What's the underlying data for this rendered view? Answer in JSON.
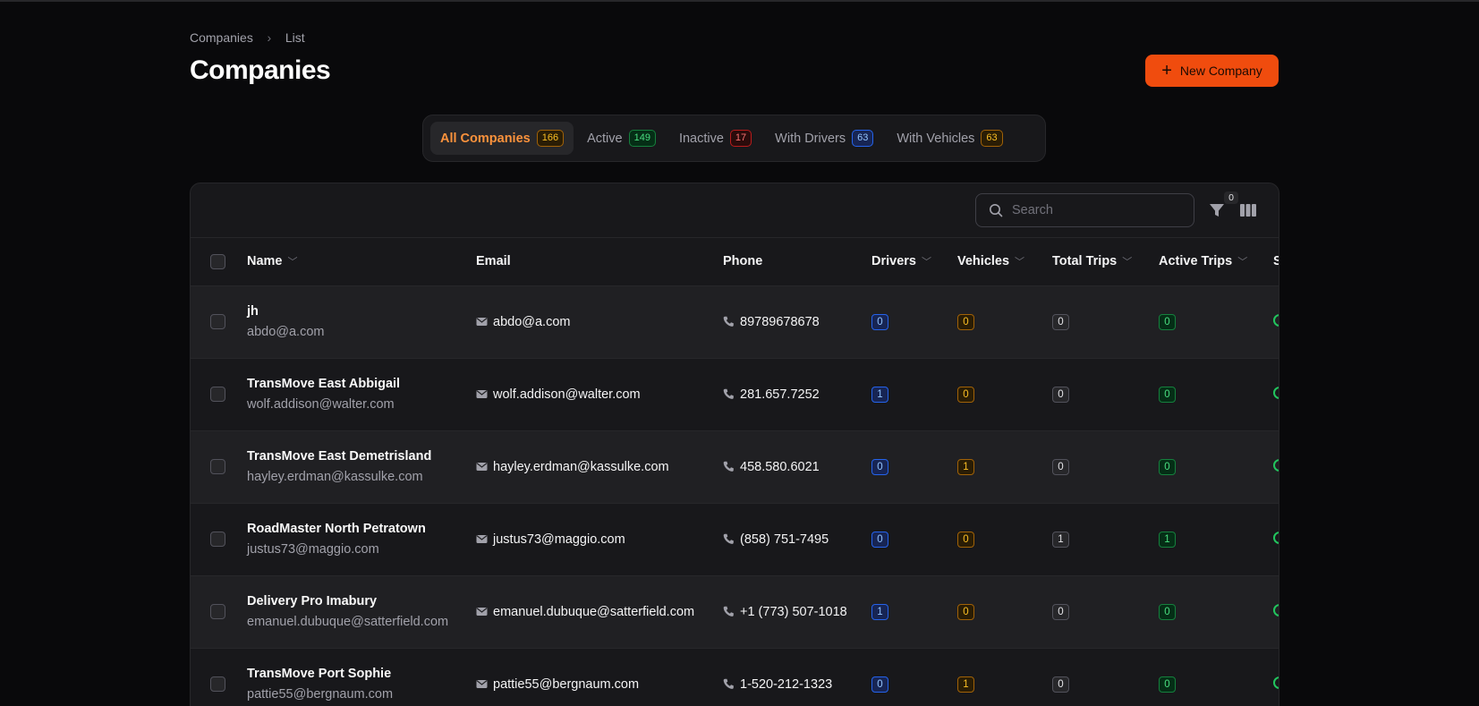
{
  "breadcrumb": {
    "parent": "Companies",
    "separator": "›",
    "current": "List"
  },
  "page": {
    "title": "Companies"
  },
  "actions": {
    "new_company": "New Company"
  },
  "tabs": [
    {
      "label": "All Companies",
      "count": "166",
      "color": "amber"
    },
    {
      "label": "Active",
      "count": "149",
      "color": "green"
    },
    {
      "label": "Inactive",
      "count": "17",
      "color": "red"
    },
    {
      "label": "With Drivers",
      "count": "63",
      "color": "blue"
    },
    {
      "label": "With Vehicles",
      "count": "63",
      "color": "amber"
    }
  ],
  "toolbar": {
    "search_placeholder": "Search",
    "filter_count": "0"
  },
  "table": {
    "headers": {
      "name": "Name",
      "email": "Email",
      "phone": "Phone",
      "drivers": "Drivers",
      "vehicles": "Vehicles",
      "total_trips": "Total Trips",
      "active_trips": "Active Trips",
      "status": "S"
    },
    "rows": [
      {
        "name": "jh",
        "sub_email": "abdo@a.com",
        "email": "abdo@a.com",
        "phone": "89789678678",
        "drivers": "0",
        "vehicles": "0",
        "total_trips": "0",
        "active_trips": "0"
      },
      {
        "name": "TransMove East Abbigail",
        "sub_email": "wolf.addison@walter.com",
        "email": "wolf.addison@walter.com",
        "phone": "281.657.7252",
        "drivers": "1",
        "vehicles": "0",
        "total_trips": "0",
        "active_trips": "0"
      },
      {
        "name": "TransMove East Demetrisland",
        "sub_email": "hayley.erdman@kassulke.com",
        "email": "hayley.erdman@kassulke.com",
        "phone": "458.580.6021",
        "drivers": "0",
        "vehicles": "1",
        "total_trips": "0",
        "active_trips": "0"
      },
      {
        "name": "RoadMaster North Petratown",
        "sub_email": "justus73@maggio.com",
        "email": "justus73@maggio.com",
        "phone": "(858) 751-7495",
        "drivers": "0",
        "vehicles": "0",
        "total_trips": "1",
        "active_trips": "1"
      },
      {
        "name": "Delivery Pro Imabury",
        "sub_email": "emanuel.dubuque@satterfield.com",
        "email": "emanuel.dubuque@satterfield.com",
        "phone": "+1 (773) 507-1018",
        "drivers": "1",
        "vehicles": "0",
        "total_trips": "0",
        "active_trips": "0"
      },
      {
        "name": "TransMove Port Sophie",
        "sub_email": "pattie55@bergnaum.com",
        "email": "pattie55@bergnaum.com",
        "phone": "1-520-212-1323",
        "drivers": "0",
        "vehicles": "1",
        "total_trips": "0",
        "active_trips": "0"
      }
    ]
  },
  "colors": {
    "accent": "#f04c0e",
    "tab_active": "#fb923c",
    "status_active": "#22c55e"
  }
}
